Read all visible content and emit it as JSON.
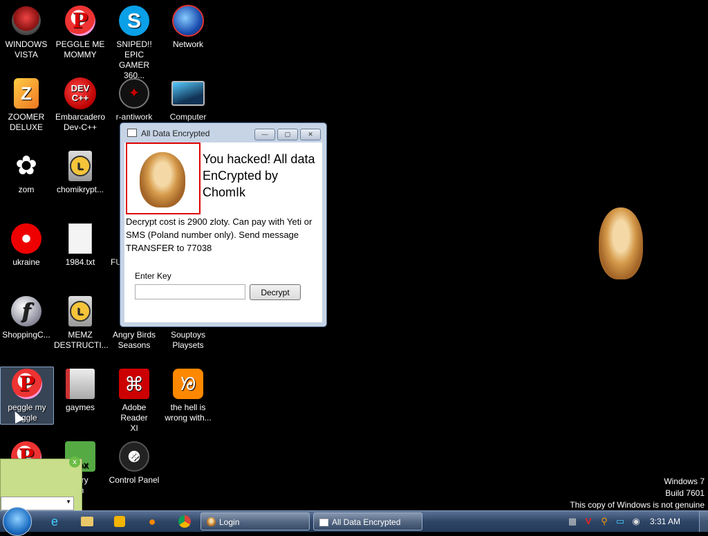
{
  "desktop": {
    "icons": [
      {
        "label": "WINDOWS\nVISTA"
      },
      {
        "label": "PEGGLE ME\nMOMMY"
      },
      {
        "label": "SNIPED!! EPIC\nGAMER 360..."
      },
      {
        "label": "Network"
      },
      {
        "label": "ZOOMER\nDELUXE"
      },
      {
        "label": "Embarcadero\nDev-C++"
      },
      {
        "label": "r-antiwork"
      },
      {
        "label": "Computer"
      },
      {
        "label": "zom"
      },
      {
        "label": "chomikrypt..."
      },
      {
        "label": "ukraine"
      },
      {
        "label": "1984.txt"
      },
      {
        "label": "FU"
      },
      {
        "label": "ShoppingC..."
      },
      {
        "label": "MEMZ\nDESTRUCTI..."
      },
      {
        "label": "Angry Birds\nSeasons"
      },
      {
        "label": "Souptoys\nPlaysets"
      },
      {
        "label": "peggle my\neggle"
      },
      {
        "label": "gaymes"
      },
      {
        "label": "Adobe Reader\nXI"
      },
      {
        "label": "the hell is\nwrong with..."
      },
      {
        "label": "iurry\nrn"
      },
      {
        "label": "Control Panel"
      }
    ],
    "icon_glyphs": {
      "peggle": "P",
      "skype": "S",
      "zoomer": "Z",
      "dev": "DEV\nC++",
      "flash": "f",
      "box": "BOX"
    }
  },
  "dialog": {
    "title": "All Data Encrypted",
    "minimize_glyph": "—",
    "maximize_glyph": "▢",
    "close_glyph": "✕",
    "headline_line1": "You hacked! All data",
    "headline_line2": "EnCrypted by ChomIk",
    "body": "Decrypt cost is 2900 zloty. Can pay with Yeti or SMS (Poland number only). Send message TRANSFER to 77038",
    "enter_key_label": "Enter Key",
    "key_value": "",
    "decrypt_button": "Decrypt"
  },
  "watermark": {
    "line1": "Windows 7",
    "line2": "Build 7601",
    "line3": "This copy of Windows is not genuine"
  },
  "taskbar": {
    "buttons": [
      {
        "label": "Login"
      },
      {
        "label": "All Data Encrypted"
      }
    ],
    "clock": "3:31 AM"
  },
  "green_window": {
    "close_glyph": "x",
    "dropdown_glyph": "▼"
  },
  "colors": {
    "desktop_bg": "#000000",
    "dialog_frame": "#c6d4e6",
    "hamster_frame": "#dd0000",
    "taskbar": "#2e4566"
  }
}
